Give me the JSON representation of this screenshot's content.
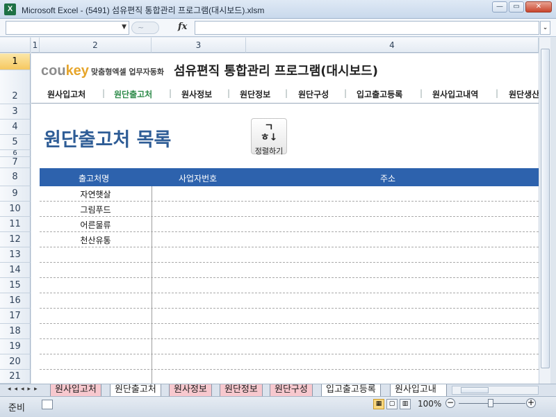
{
  "window": {
    "title": "Microsoft Excel - (5491) 섬유편직 통합관리 프로그램(대시보드).xlsm",
    "app_icon": "X"
  },
  "formula_bar": {
    "fx_label": "fx",
    "cancel_symbol": "~"
  },
  "columns": [
    "1",
    "2",
    "3",
    "4"
  ],
  "rows": [
    "1",
    "2",
    "3",
    "4",
    "5",
    "6",
    "7",
    "8",
    "9",
    "10",
    "11",
    "12",
    "13",
    "14",
    "15",
    "16",
    "17",
    "18",
    "19",
    "20",
    "21"
  ],
  "header": {
    "logo_main": "cou",
    "logo_accent": "key",
    "logo_tagline": "맞춤형엑셀 업무자동화",
    "app_title": "섬유편직 통합관리 프로그램(대시보드)"
  },
  "nav": [
    {
      "label": "원사입고처",
      "active": false
    },
    {
      "label": "원단출고처",
      "active": true
    },
    {
      "label": "원사정보",
      "active": false
    },
    {
      "label": "원단정보",
      "active": false
    },
    {
      "label": "원단구성",
      "active": false
    },
    {
      "label": "입고출고등록",
      "active": false
    },
    {
      "label": "원사입고내역",
      "active": false
    },
    {
      "label": "원단생산",
      "active": false
    }
  ],
  "page": {
    "heading": "원단출고처 목록",
    "sort_button": {
      "icon": "ㄱ\nㅎ↓",
      "label": "정렬하기"
    }
  },
  "table": {
    "columns": [
      "출고처명",
      "사업자번호",
      "주소"
    ],
    "rows": [
      [
        "자연햇살",
        "",
        ""
      ],
      [
        "그림푸드",
        "",
        ""
      ],
      [
        "어른물류",
        "",
        ""
      ],
      [
        "천산유통",
        "",
        ""
      ]
    ]
  },
  "sheet_tabs": [
    {
      "label": "원사입고처",
      "style": "pink"
    },
    {
      "label": "원단출고처",
      "style": "white"
    },
    {
      "label": "원사정보",
      "style": "pink"
    },
    {
      "label": "원단정보",
      "style": "pink"
    },
    {
      "label": "원단구성",
      "style": "pink"
    },
    {
      "label": "입고출고등록",
      "style": "white"
    },
    {
      "label": "원사입고내",
      "style": "white"
    }
  ],
  "status": {
    "ready": "준비",
    "zoom": "100%"
  }
}
